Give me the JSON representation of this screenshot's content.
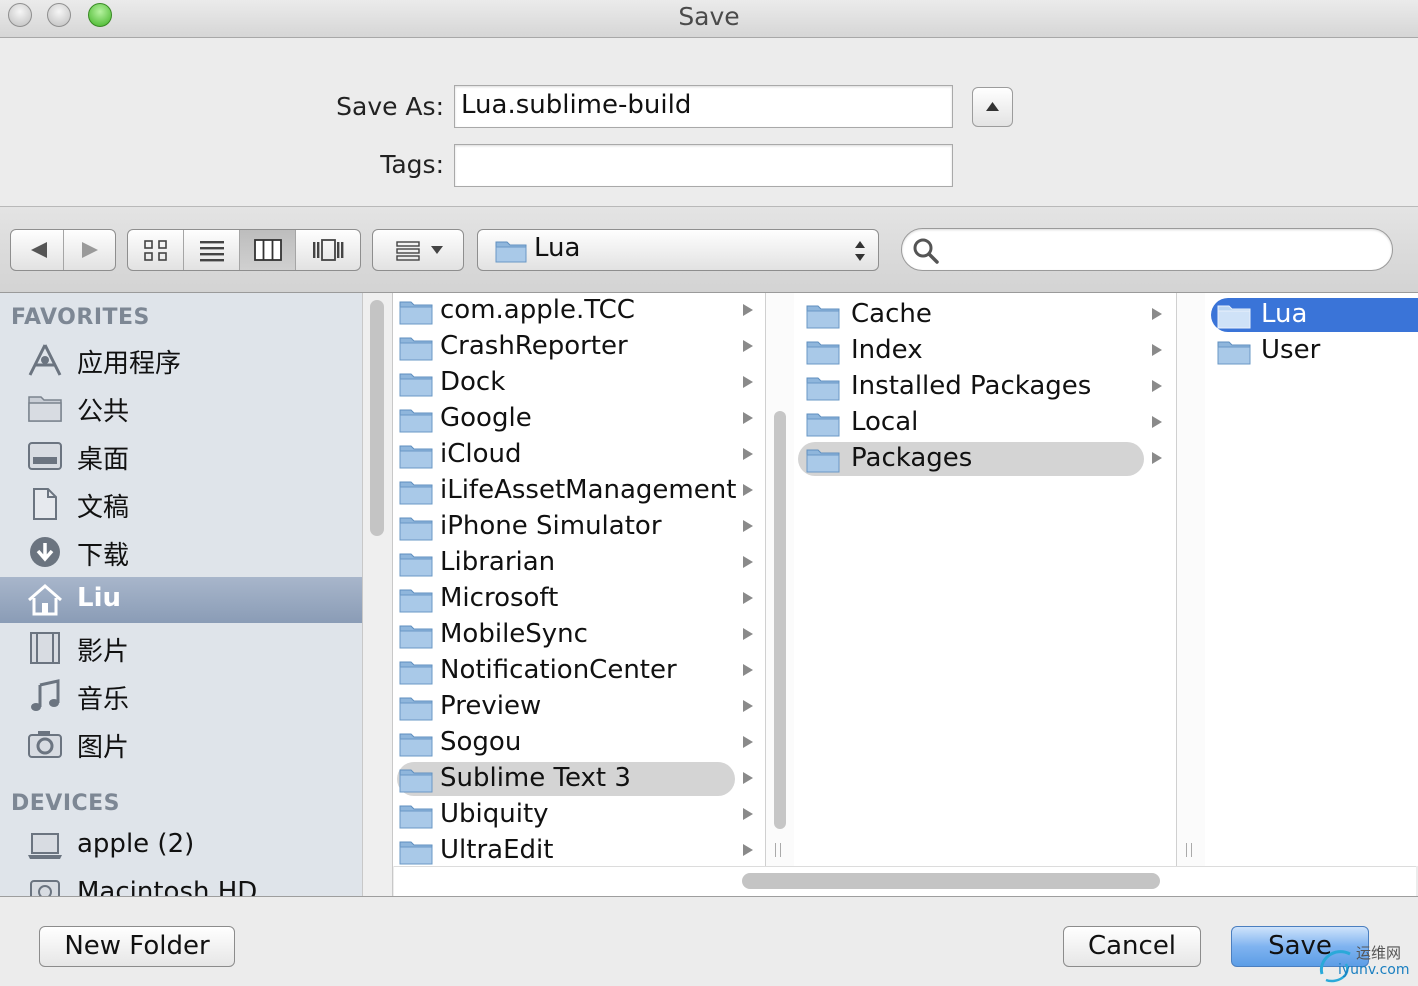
{
  "window": {
    "title": "Save"
  },
  "form": {
    "save_as_label": "Save As:",
    "save_as_value": "Lua.sublime-build",
    "tags_label": "Tags:",
    "tags_value": ""
  },
  "toolbar": {
    "location": "Lua",
    "search_value": ""
  },
  "sidebar": {
    "favorites_header": "FAVORITES",
    "favorites": [
      {
        "label": "应用程序",
        "icon": "applications-icon"
      },
      {
        "label": "公共",
        "icon": "folder-icon"
      },
      {
        "label": "桌面",
        "icon": "desktop-icon"
      },
      {
        "label": "文稿",
        "icon": "documents-icon"
      },
      {
        "label": "下载",
        "icon": "downloads-icon"
      },
      {
        "label": "Liu",
        "icon": "home-icon"
      },
      {
        "label": "影片",
        "icon": "movies-icon"
      },
      {
        "label": "音乐",
        "icon": "music-icon"
      },
      {
        "label": "图片",
        "icon": "pictures-icon"
      }
    ],
    "devices_header": "DEVICES",
    "devices": [
      {
        "label": "apple (2)",
        "icon": "laptop-icon"
      },
      {
        "label": "Macintosh HD",
        "icon": "hard-drive-icon"
      }
    ]
  },
  "columns": {
    "col1": [
      "com.apple.TCC",
      "CrashReporter",
      "Dock",
      "Google",
      "iCloud",
      "iLifeAssetManagement",
      "iPhone Simulator",
      "Librarian",
      "Microsoft",
      "MobileSync",
      "NotificationCenter",
      "Preview",
      "Sogou",
      "Sublime Text 3",
      "Ubiquity",
      "UltraEdit"
    ],
    "col2": [
      "Cache",
      "Index",
      "Installed Packages",
      "Local",
      "Packages"
    ],
    "col3": [
      "Lua",
      "User"
    ]
  },
  "buttons": {
    "new_folder": "New Folder",
    "cancel": "Cancel",
    "save": "Save"
  },
  "watermark": {
    "line1": "运维网",
    "line2": "iyunv.com"
  },
  "colors": {
    "selection_blue": "#3a74d8",
    "sidebar_bg": "#dfe4ea",
    "sidebar_selected": "#8a9cb6"
  }
}
